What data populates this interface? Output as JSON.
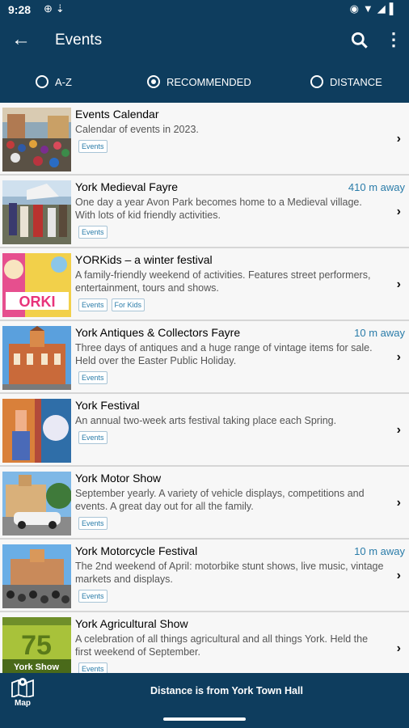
{
  "status": {
    "time": "9:28",
    "left_icons": [
      "browser-icon",
      "usb-icon"
    ],
    "right_icons": [
      "location-icon",
      "wifi-icon",
      "signal-icon",
      "battery-icon"
    ]
  },
  "appbar": {
    "title": "Events"
  },
  "sort": {
    "options": [
      {
        "label": "A-Z",
        "selected": false
      },
      {
        "label": "RECOMMENDED",
        "selected": true
      },
      {
        "label": "DISTANCE",
        "selected": false
      }
    ]
  },
  "events": [
    {
      "name": "Events Calendar",
      "distance": "",
      "description": "Calendar of events in 2023.",
      "tags": [
        "Events"
      ]
    },
    {
      "name": "York Medieval Fayre",
      "distance": "410 m away",
      "description": "One day a year Avon Park becomes home to a Medieval village. With lots of kid friendly activities.",
      "tags": [
        "Events"
      ]
    },
    {
      "name": "YORKids – a winter festival",
      "distance": "",
      "description": "A family-friendly weekend of activities. Features street performers, entertainment, tours and shows.",
      "tags": [
        "Events",
        "For Kids"
      ]
    },
    {
      "name": "York Antiques & Collectors Fayre",
      "distance": "10 m away",
      "description": "Three days of antiques and a huge range of vintage items for sale. Held over the Easter Public Holiday.",
      "tags": [
        "Events"
      ]
    },
    {
      "name": "York Festival",
      "distance": "",
      "description": "An annual two-week arts festival taking place each Spring.",
      "tags": [
        "Events"
      ]
    },
    {
      "name": "York Motor Show",
      "distance": "",
      "description": "September yearly. A variety of vehicle displays, competitions and events. A great day out for all the family.",
      "tags": [
        "Events"
      ]
    },
    {
      "name": "York Motorcycle Festival",
      "distance": "10 m away",
      "description": "The 2nd weekend of April: motorbike stunt shows, live music, vintage markets and displays.",
      "tags": [
        "Events"
      ]
    },
    {
      "name": "York Agricultural Show",
      "distance": "",
      "description": "A celebration of all things agricultural and all things York. Held the first weekend of September.",
      "tags": [
        "Events"
      ]
    }
  ],
  "thumb_text": {
    "yorkids": "ORKI",
    "ag_number": "75",
    "ag_title": "York Show"
  },
  "bottom": {
    "map_label": "Map",
    "distance_note": "Distance is from York Town Hall"
  },
  "colors": {
    "bar": "#0e3d5e",
    "accent": "#2a7ca9"
  }
}
